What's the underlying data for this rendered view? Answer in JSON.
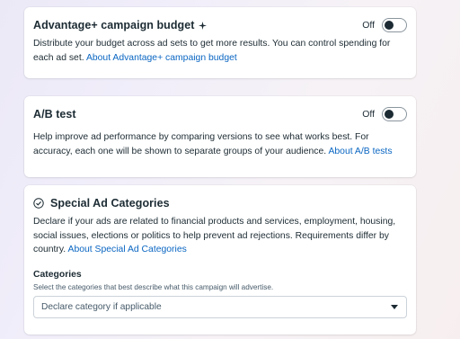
{
  "budget": {
    "title": "Advantage+ campaign budget",
    "toggle_state": "Off",
    "description": "Distribute your budget across ad sets to get more results. You can control spending for each ad set. ",
    "link": "About Advantage+ campaign budget"
  },
  "ab_test": {
    "title": "A/B test",
    "toggle_state": "Off",
    "description": "Help improve ad performance by comparing versions to see what works best. For accuracy, each one will be shown to separate groups of your audience. ",
    "link": "About A/B tests"
  },
  "special_ad_categories": {
    "title": "Special Ad Categories",
    "description": "Declare if your ads are related to financial products and services, employment, housing, social issues, elections or politics to help prevent ad rejections. Requirements differ by country. ",
    "link": "About Special Ad Categories",
    "categories_label": "Categories",
    "categories_help": "Select the categories that best describe what this campaign will advertise.",
    "categories_select_value": "Declare category if applicable"
  },
  "icons": {
    "sparkle": "sparkle-icon",
    "check": "check-circle-icon",
    "caret": "caret-down-icon"
  },
  "colors": {
    "link": "#0a66c2",
    "text": "#1c2b33",
    "toggle_knob": "#1c2b33"
  }
}
